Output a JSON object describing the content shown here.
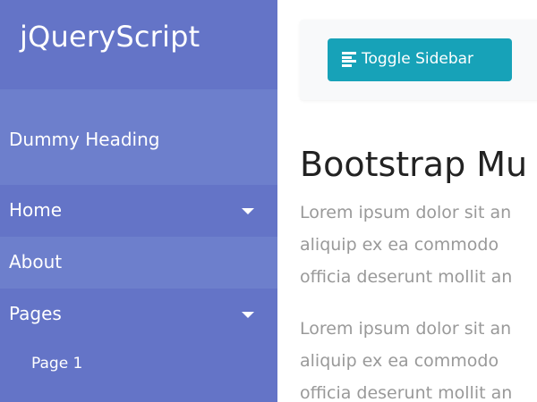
{
  "sidebar": {
    "brand": "jQueryScript",
    "heading": "Dummy Heading",
    "items": [
      {
        "label": "Home"
      },
      {
        "label": "About"
      },
      {
        "label": "Pages"
      }
    ],
    "subitems": [
      {
        "label": "Page 1"
      }
    ]
  },
  "navbar": {
    "toggle_label": "Toggle Sidebar",
    "toggle_icon": "align-left-icon"
  },
  "main": {
    "heading": "Bootstrap Mu",
    "paragraphs": [
      {
        "lines": [
          "Lorem ipsum dolor sit an",
          "aliquip ex ea commodo",
          "officia deserunt mollit an"
        ]
      },
      {
        "lines": [
          "Lorem ipsum dolor sit an",
          "aliquip ex ea commodo",
          "officia deserunt mollit an"
        ]
      }
    ]
  },
  "colors": {
    "sidebar": "#6d7fcc",
    "sidebar_dark": "#6474c7",
    "button": "#17a2b8",
    "heading_text": "#222222",
    "body_text": "#999999"
  }
}
